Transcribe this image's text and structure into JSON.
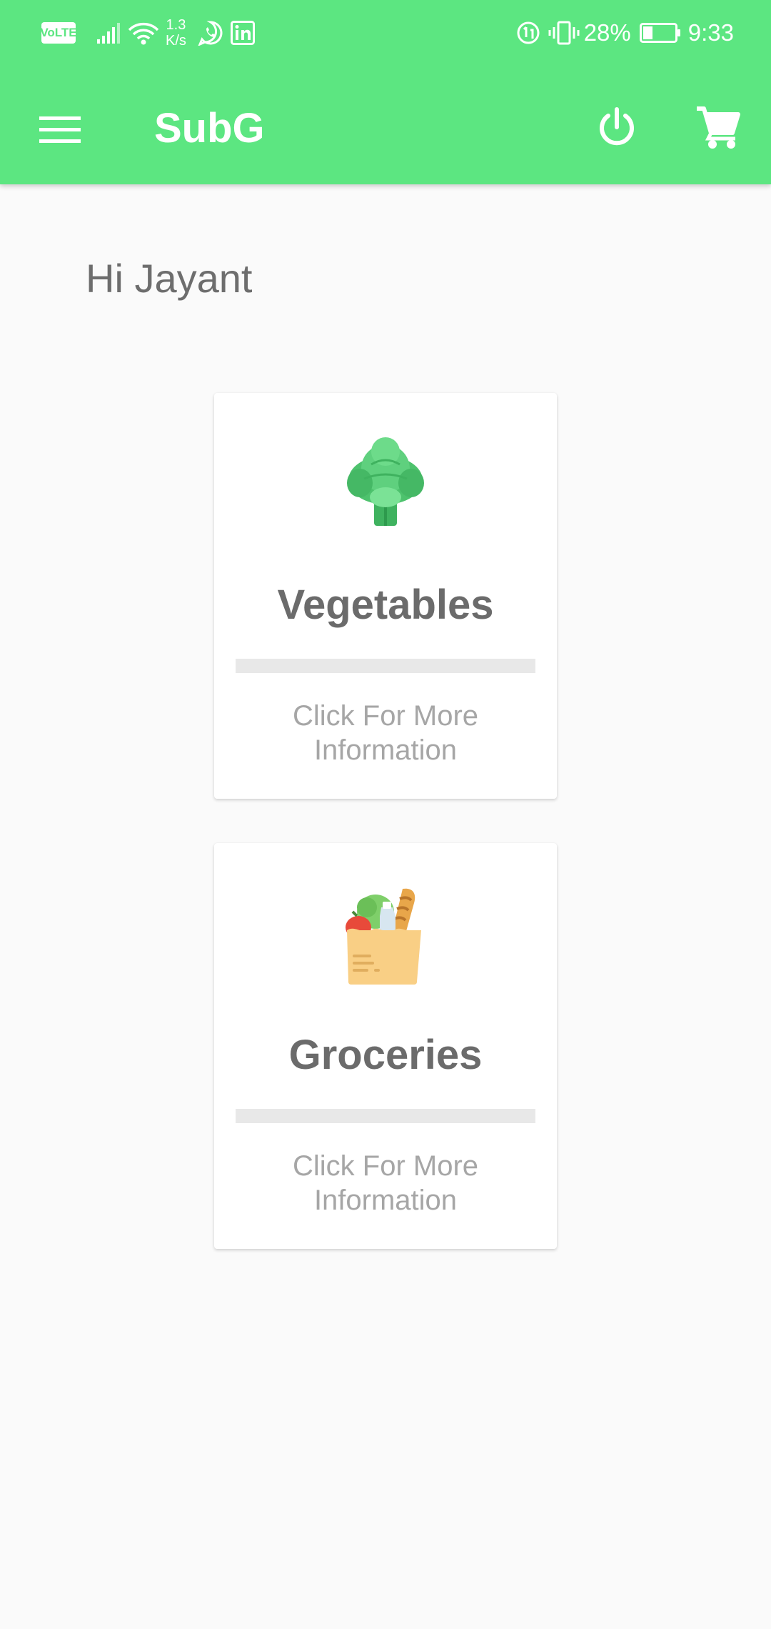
{
  "status_bar": {
    "volte": "VoLTE",
    "speed_value": "1.3",
    "speed_unit": "K/s",
    "battery_percent": "28%",
    "time": "9:33",
    "icons": [
      "volte-icon",
      "signal-icon",
      "wifi-icon",
      "whatsapp-icon",
      "linkedin-icon",
      "data-saver-icon",
      "vibrate-icon",
      "battery-icon"
    ]
  },
  "app_bar": {
    "title": "SubG",
    "icons": [
      "menu-icon",
      "power-icon",
      "cart-icon"
    ]
  },
  "greeting": "Hi Jayant",
  "categories": [
    {
      "title": "Vegetables",
      "subtitle": "Click For More Information",
      "icon": "artichoke-icon"
    },
    {
      "title": "Groceries",
      "subtitle": "Click For More Information",
      "icon": "grocery-bag-icon"
    }
  ],
  "colors": {
    "primary": "#5ce681",
    "background": "#fafafa",
    "card": "#ffffff",
    "title_text": "#6b6b6b",
    "subtitle_text": "#a6a6a6"
  }
}
